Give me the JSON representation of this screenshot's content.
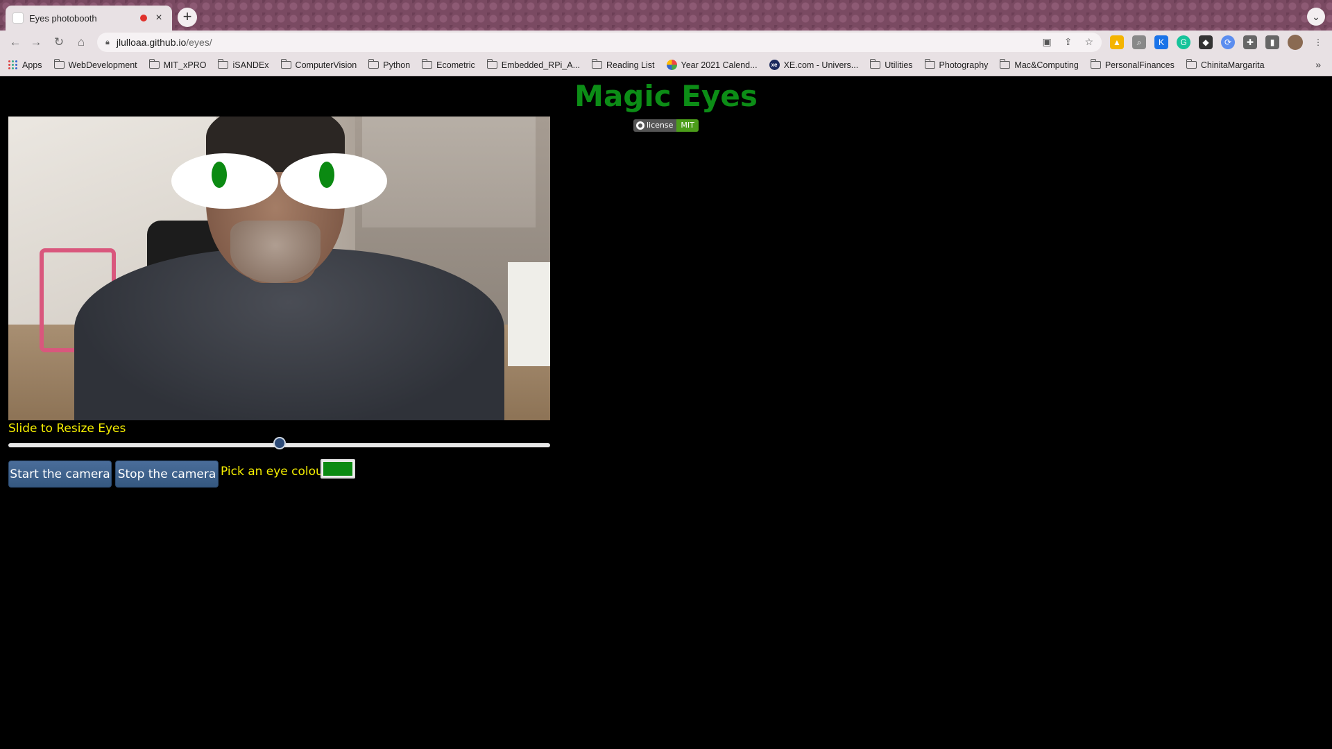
{
  "browser": {
    "tab_title": "Eyes photobooth",
    "tab_close": "×",
    "new_tab": "+",
    "tab_search": "⌄",
    "url_host": "jlulloaa.github.io",
    "url_path": "/eyes/",
    "nav": {
      "back": "←",
      "forward": "→",
      "reload": "↻",
      "home": "⌂"
    },
    "omni_icons": [
      "camera-icon",
      "share-icon",
      "star-icon"
    ],
    "extensions": [
      {
        "icon": "google-drive-icon",
        "color": "#f4b400"
      },
      {
        "icon": "zoom-icon",
        "color": "#777777"
      },
      {
        "icon": "k-icon",
        "color": "#1a73e8"
      },
      {
        "icon": "grammarly-icon",
        "color": "#15c39a"
      },
      {
        "icon": "cube-icon",
        "color": "#333333"
      },
      {
        "icon": "sync-icon",
        "color": "#5b8def"
      },
      {
        "icon": "puzzle-icon",
        "color": "#555555"
      },
      {
        "icon": "sidepanel-icon",
        "color": "#555555"
      }
    ],
    "bookmarks": [
      {
        "label": "Apps",
        "icon": "apps-icon"
      },
      {
        "label": "WebDevelopment",
        "icon": "folder-icon"
      },
      {
        "label": "MIT_xPRO",
        "icon": "folder-icon"
      },
      {
        "label": "iSANDEx",
        "icon": "folder-icon"
      },
      {
        "label": "ComputerVision",
        "icon": "folder-icon"
      },
      {
        "label": "Python",
        "icon": "folder-icon"
      },
      {
        "label": "Ecometric",
        "icon": "folder-icon"
      },
      {
        "label": "Embedded_RPi_A...",
        "icon": "folder-icon"
      },
      {
        "label": "Reading List",
        "icon": "folder-icon"
      },
      {
        "label": "Year 2021 Calend...",
        "icon": "calendar-site-icon"
      },
      {
        "label": "XE.com - Univers...",
        "icon": "xe-site-icon"
      },
      {
        "label": "Utilities",
        "icon": "folder-icon"
      },
      {
        "label": "Photography",
        "icon": "folder-icon"
      },
      {
        "label": "Mac&Computing",
        "icon": "folder-icon"
      },
      {
        "label": "PersonalFinances",
        "icon": "folder-icon"
      },
      {
        "label": "ChinitaMargarita",
        "icon": "folder-icon"
      }
    ],
    "bookmarks_more": "»"
  },
  "page": {
    "title": "Magic Eyes",
    "badge_left": "license",
    "badge_right": "MIT",
    "slider_label": "Slide to Resize Eyes",
    "slider_value_fraction": 0.5,
    "start_button": "Start the camera",
    "stop_button": "Stop the camera",
    "colour_label": "Pick an eye colour:",
    "eye_colour": "#0b8a12",
    "title_color": "#0c8d16",
    "label_color": "#f7f000"
  }
}
